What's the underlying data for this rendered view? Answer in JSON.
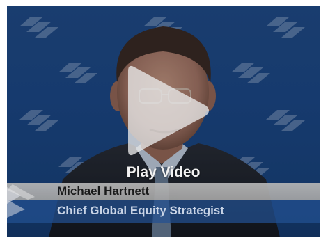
{
  "video": {
    "play_label": "Play Video",
    "play_icon": "play-icon",
    "brand_mark_icon": "flagscape-logo-icon"
  },
  "lower_third": {
    "name": "Michael Hartnett",
    "title": "Chief Global Equity Strategist"
  },
  "colors": {
    "background_blue": "#1d4b8d",
    "name_bar": "#b0b0b0",
    "title_bar": "#235091",
    "play_button": "#e6e6e6"
  }
}
